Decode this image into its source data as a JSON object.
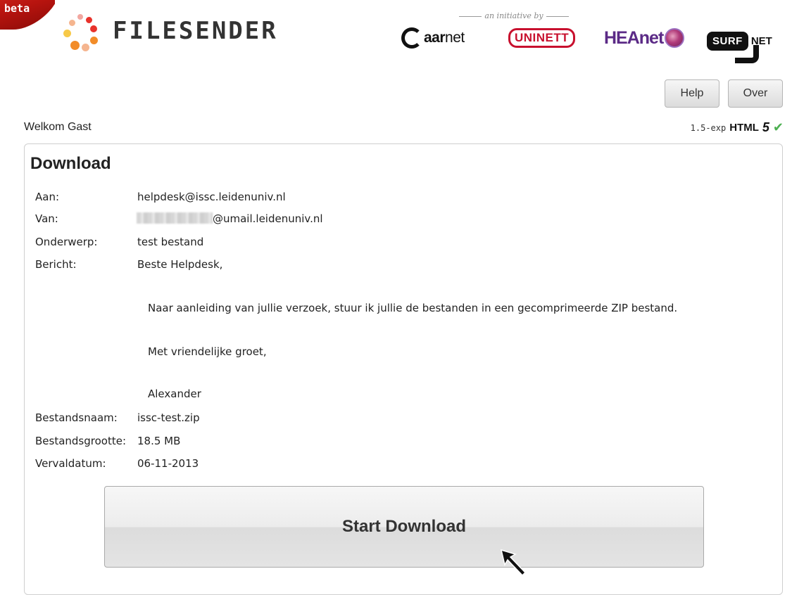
{
  "header": {
    "beta_label": "beta",
    "brand": "FILESENDER",
    "initiative_text": "an initiative by",
    "partners": {
      "aarnet_bold": "aar",
      "aarnet_rest": "net",
      "uninett": "UNINETT",
      "heanet": "HEAnet",
      "surf": "SURF",
      "net": "NET"
    }
  },
  "toolbar": {
    "help_label": "Help",
    "over_label": "Over"
  },
  "welcome": "Welkom Gast",
  "version": {
    "number": "1.5-exp",
    "html": "HTML",
    "five": "5"
  },
  "download": {
    "title": "Download",
    "fields": {
      "aan": {
        "label": "Aan:",
        "value": "helpdesk@issc.leidenuniv.nl"
      },
      "van": {
        "label": "Van:",
        "value": "@umail.leidenuniv.nl"
      },
      "onderwerp": {
        "label": "Onderwerp:",
        "value": "test bestand"
      },
      "bericht": {
        "label": "Bericht:",
        "lines": [
          "Beste Helpdesk,",
          "Naar aanleiding van jullie verzoek, stuur ik jullie de bestanden in een gecomprimeerde ZIP bestand.",
          "Met vriendelijke groet,",
          "Alexander"
        ]
      },
      "bestandsnaam": {
        "label": "Bestandsnaam:",
        "value": "issc-test.zip"
      },
      "bestandsgrootte": {
        "label": "Bestandsgrootte:",
        "value": "18.5 MB"
      },
      "vervaldatum": {
        "label": "Vervaldatum:",
        "value": "06-11-2013"
      }
    },
    "start_label": "Start Download"
  },
  "colors": {
    "accent_red": "#c8102e",
    "heanet_purple": "#5b2a86",
    "check_green": "#4caf50"
  }
}
